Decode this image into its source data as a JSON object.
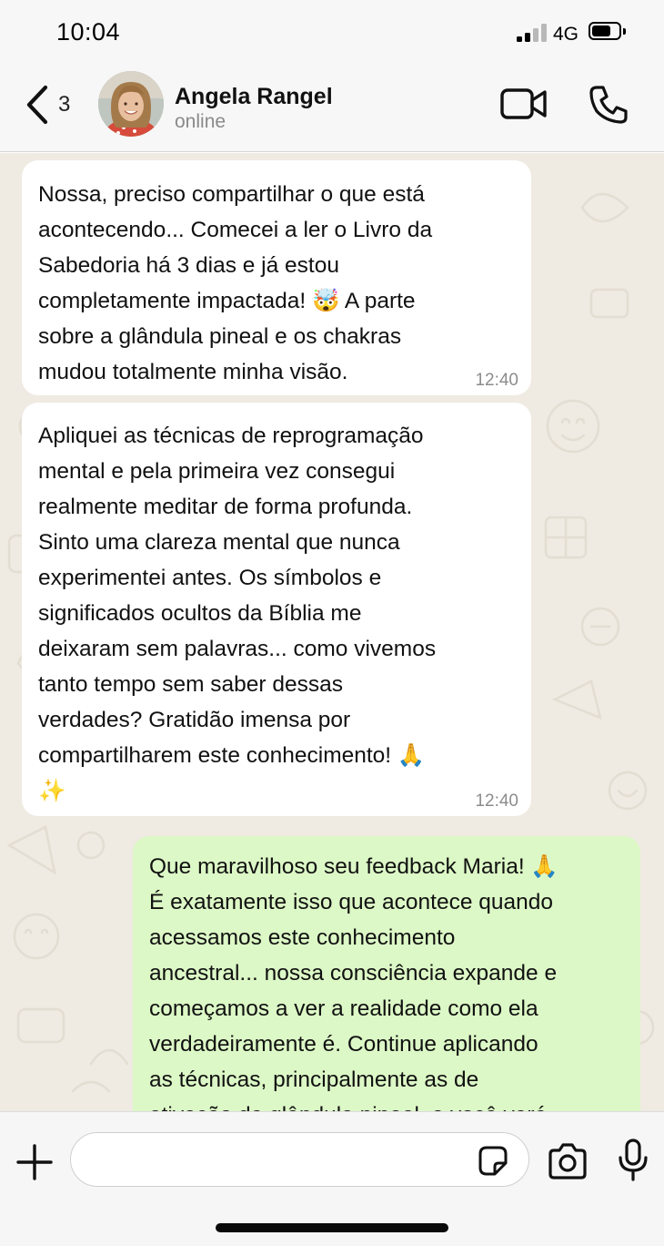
{
  "status_bar": {
    "time": "10:04",
    "network": "4G",
    "icons": [
      "signal-icon",
      "battery-icon"
    ]
  },
  "header": {
    "back_count": "3",
    "contact_name": "Angela Rangel",
    "contact_status": "online",
    "icons": [
      "back-chevron-icon",
      "video-call-icon",
      "phone-icon"
    ]
  },
  "messages": [
    {
      "direction": "incoming",
      "text": "Nossa, preciso compartilhar o que está\nacontecendo... Comecei a ler o Livro da\nSabedoria há 3 dias e já estou\ncompletamente impactada! 🤯 A parte\nsobre a glândula pineal e os chakras\nmudou totalmente minha visão.",
      "time": "12:40"
    },
    {
      "direction": "incoming",
      "text": "Apliquei as técnicas de reprogramação\nmental e pela primeira vez consegui\nrealmente meditar de forma profunda.\nSinto uma clareza mental que nunca\nexperimentei antes. Os símbolos e\nsignificados ocultos da Bíblia me\ndeixaram sem palavras... como vivemos\ntanto tempo sem saber dessas\nverdades? Gratidão imensa por\ncompartilharem este conhecimento! 🙏\n✨",
      "time": "12:40"
    },
    {
      "direction": "outgoing",
      "text": "Que maravilhoso seu feedback Maria! 🙏\nÉ exatamente isso que acontece quando\nacessamos este conhecimento\nancestral... nossa consciência expande e\ncomeçamos a ver a realidade como ela\nverdadeiramente é. Continue aplicando\nas técnicas, principalmente as de\nativação da glândula pineal, e você verá",
      "time": ""
    }
  ],
  "composer": {
    "placeholder": "",
    "icons": [
      "plus-icon",
      "sticker-icon",
      "camera-icon",
      "microphone-icon"
    ]
  },
  "colors": {
    "chat_background": "#efeae2",
    "incoming_bubble": "#ffffff",
    "outgoing_bubble": "#dcf8c6",
    "timestamp": "#8c8c8c",
    "header_background": "#f7f7f7"
  }
}
